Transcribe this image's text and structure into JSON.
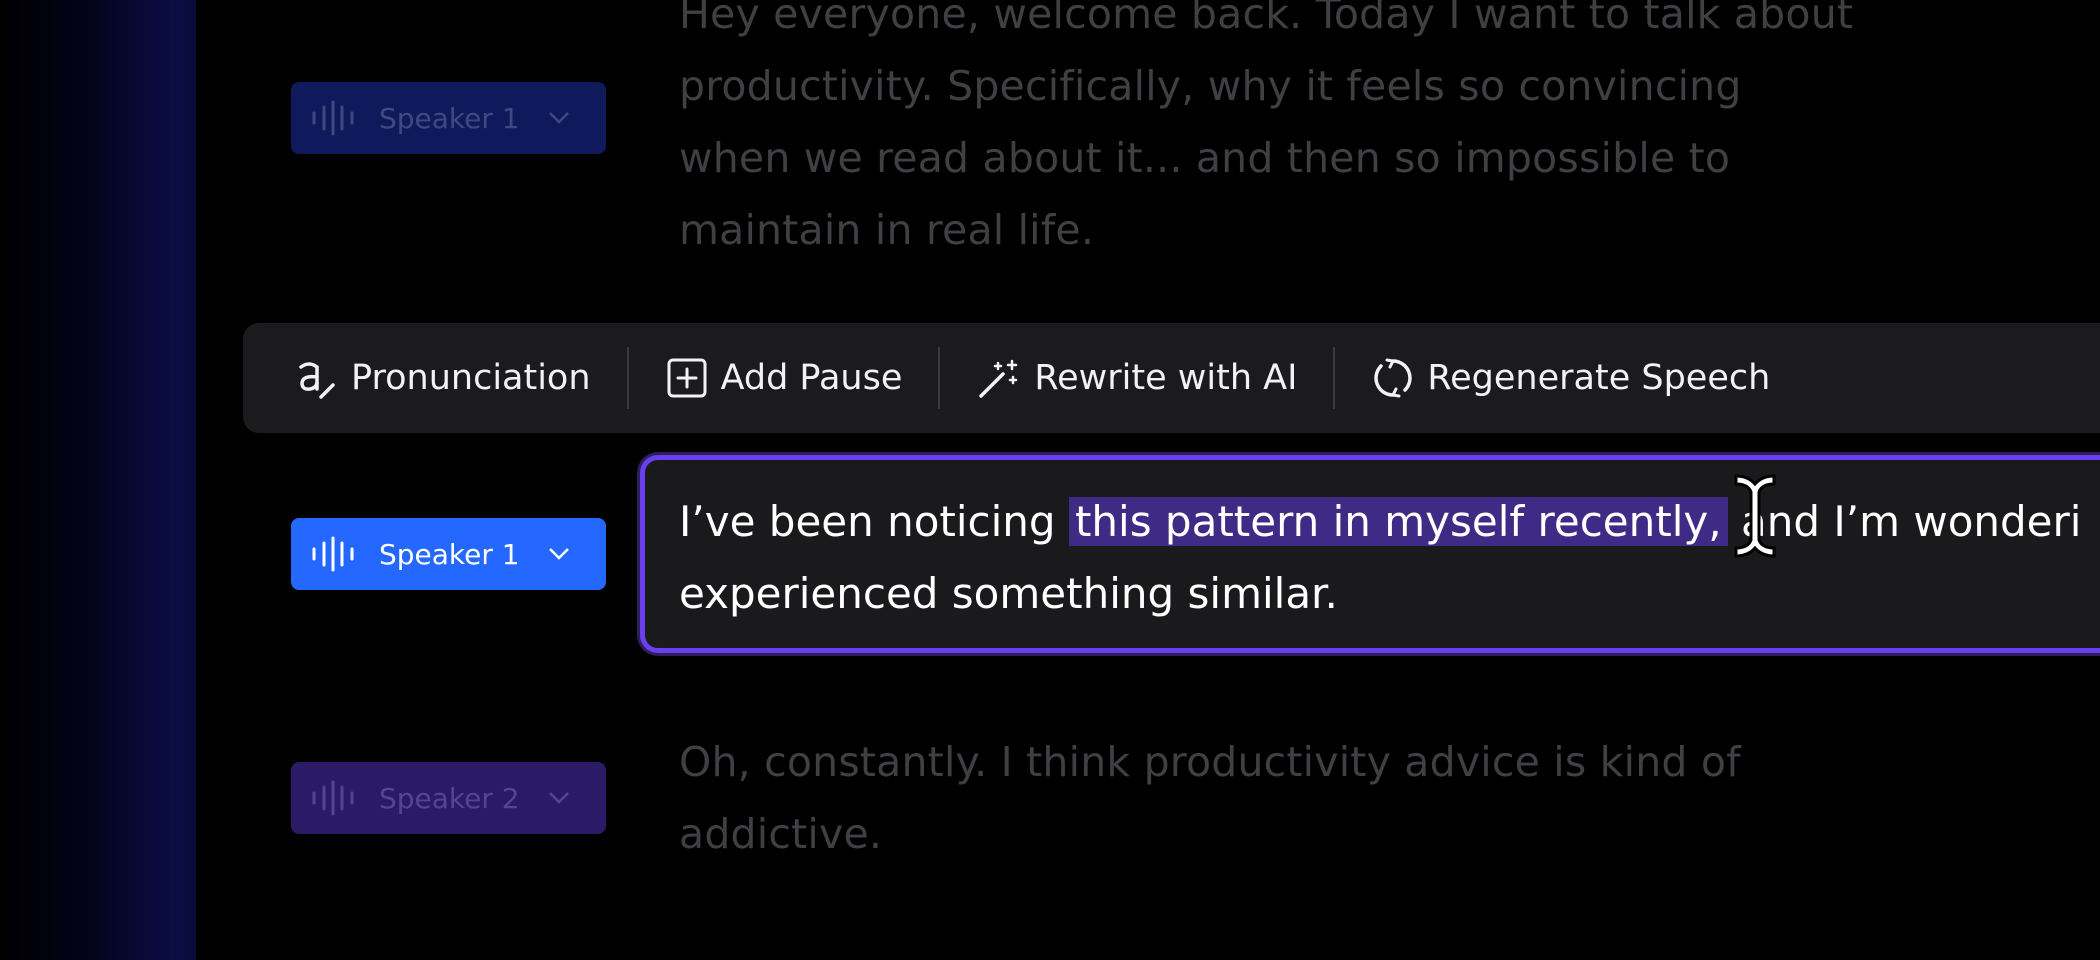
{
  "colors": {
    "accent_blue": "#2468ff",
    "accent_purple": "#6a3ff0",
    "selection": "#3f2b85",
    "toolbar_bg": "#1b1b1d",
    "dim_text": "#3f3f44"
  },
  "segments": [
    {
      "speaker": "Speaker 1",
      "text": "Hey everyone, welcome back. Today I want to talk about productivity. Specifically, why it feels so convincing when we read about it... and then so impossible to maintain in real life."
    },
    {
      "speaker": "Speaker 1",
      "text_before": "I’ve been noticing ",
      "text_selected": "this pattern in myself recently,",
      "text_after": " and I’m wonderi",
      "text_line2": "experienced something similar."
    },
    {
      "speaker": "Speaker 2",
      "text": "Oh, constantly. I think productivity advice is kind of addictive."
    }
  ],
  "toolbar": {
    "pronunciation_label": "Pronunciation",
    "pronunciation_icon": "pronunciation-icon",
    "add_pause_label": "Add Pause",
    "add_pause_icon": "plus-square-icon",
    "rewrite_label": "Rewrite with AI",
    "rewrite_icon": "magic-wand-icon",
    "regenerate_label": "Regenerate Speech",
    "regenerate_icon": "refresh-icon"
  }
}
